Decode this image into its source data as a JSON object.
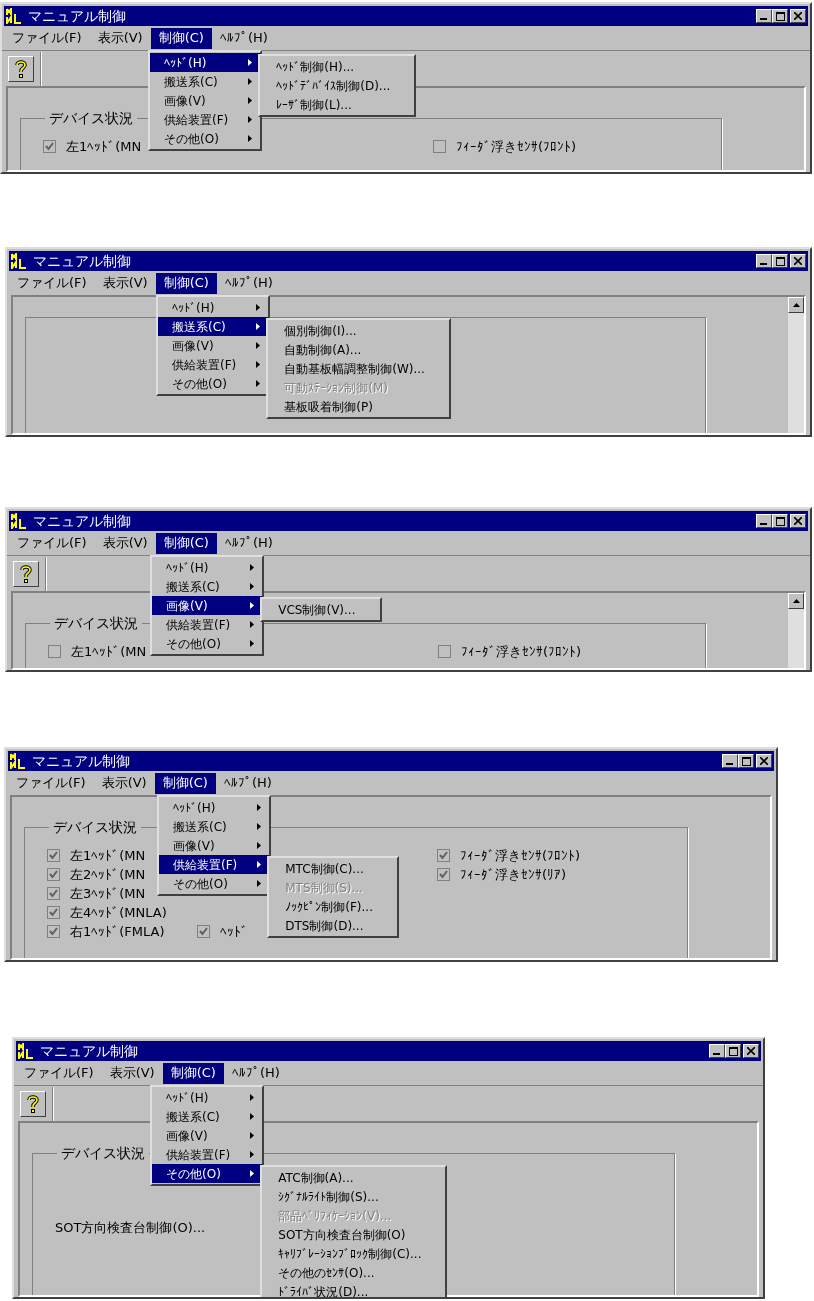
{
  "panels": [
    {
      "window": {
        "title": "マニュアル制御"
      },
      "menubar": [
        {
          "label": "ファイル(F)",
          "selected": false
        },
        {
          "label": "表示(V)",
          "selected": false
        },
        {
          "label": "制御(C)",
          "selected": true
        },
        {
          "label": "ﾍﾙﾌﾟ(H)",
          "selected": false
        }
      ],
      "toolbar": true,
      "scrollbar": false,
      "menu": [
        {
          "label": "ﾍｯﾄﾞ(H)",
          "selected": true
        },
        {
          "label": "搬送系(C)",
          "selected": false
        },
        {
          "label": "画像(V)",
          "selected": false
        },
        {
          "label": "供給装置(F)",
          "selected": false
        },
        {
          "label": "その他(O)",
          "selected": false
        }
      ],
      "submenu": [
        {
          "label": "ﾍｯﾄﾞ制御(H)...",
          "disabled": false
        },
        {
          "label": "ﾍｯﾄﾞﾃﾞﾊﾞｲｽ制御(D)...",
          "disabled": false
        },
        {
          "label": "ﾚｰｻﾞ制御(L)...",
          "disabled": false
        }
      ],
      "group": {
        "title": "デバイス状況",
        "rows": [
          {
            "left": {
              "label": "左1ﾍｯﾄﾞ(MN",
              "checked": true
            },
            "right": {
              "label": "ﾌｨｰﾀﾞ浮きｾﾝｻ(ﾌﾛﾝﾄ)",
              "checked": false
            }
          }
        ]
      }
    },
    {
      "window": {
        "title": "マニュアル制御"
      },
      "menubar": [
        {
          "label": "ファイル(F)",
          "selected": false
        },
        {
          "label": "表示(V)",
          "selected": false
        },
        {
          "label": "制御(C)",
          "selected": true
        },
        {
          "label": "ﾍﾙﾌﾟ(H)",
          "selected": false
        }
      ],
      "toolbar": false,
      "scrollbar": true,
      "menu": [
        {
          "label": "ﾍｯﾄﾞ(H)",
          "selected": false
        },
        {
          "label": "搬送系(C)",
          "selected": true
        },
        {
          "label": "画像(V)",
          "selected": false
        },
        {
          "label": "供給装置(F)",
          "selected": false
        },
        {
          "label": "その他(O)",
          "selected": false
        }
      ],
      "submenu": [
        {
          "label": "個別制御(I)...",
          "disabled": false
        },
        {
          "label": "自動制御(A)...",
          "disabled": false
        },
        {
          "label": "自動基板幅調整制御(W)...",
          "disabled": false
        },
        {
          "label": "可動ｽﾃｰｼｮﾝ制御(M)",
          "disabled": true
        },
        {
          "label": "基板吸着制御(P)",
          "disabled": false
        }
      ]
    },
    {
      "window": {
        "title": "マニュアル制御"
      },
      "menubar": [
        {
          "label": "ファイル(F)",
          "selected": false
        },
        {
          "label": "表示(V)",
          "selected": false
        },
        {
          "label": "制御(C)",
          "selected": true
        },
        {
          "label": "ﾍﾙﾌﾟ(H)",
          "selected": false
        }
      ],
      "toolbar": true,
      "scrollbar": true,
      "menu": [
        {
          "label": "ﾍｯﾄﾞ(H)",
          "selected": false
        },
        {
          "label": "搬送系(C)",
          "selected": false
        },
        {
          "label": "画像(V)",
          "selected": true
        },
        {
          "label": "供給装置(F)",
          "selected": false
        },
        {
          "label": "その他(O)",
          "selected": false
        }
      ],
      "submenu": [
        {
          "label": "VCS制御(V)...",
          "disabled": false
        }
      ],
      "group": {
        "title": "デバイス状況",
        "rows": [
          {
            "left": {
              "label": "左1ﾍｯﾄﾞ(MN",
              "checked": false
            },
            "right": {
              "label": "ﾌｨｰﾀﾞ浮きｾﾝｻ(ﾌﾛﾝﾄ)",
              "checked": false
            }
          }
        ]
      }
    },
    {
      "window": {
        "title": "マニュアル制御"
      },
      "menubar": [
        {
          "label": "ファイル(F)",
          "selected": false
        },
        {
          "label": "表示(V)",
          "selected": false
        },
        {
          "label": "制御(C)",
          "selected": true
        },
        {
          "label": "ﾍﾙﾌﾟ(H)",
          "selected": false
        }
      ],
      "toolbar": false,
      "scrollbar": false,
      "menu": [
        {
          "label": "ﾍｯﾄﾞ(H)",
          "selected": false
        },
        {
          "label": "搬送系(C)",
          "selected": false
        },
        {
          "label": "画像(V)",
          "selected": false
        },
        {
          "label": "供給装置(F)",
          "selected": true
        },
        {
          "label": "その他(O)",
          "selected": false
        }
      ],
      "submenu": [
        {
          "label": "MTC制御(C)...",
          "disabled": false
        },
        {
          "label": "MTS制御(S)...",
          "disabled": true
        },
        {
          "label": "ﾉｯｸﾋﾟﾝ制御(F)...",
          "disabled": false
        },
        {
          "label": "DTS制御(D)...",
          "disabled": false
        }
      ],
      "group": {
        "title": "デバイス状況",
        "rows": [
          {
            "left": {
              "label": "左1ﾍｯﾄﾞ(MN",
              "checked": true
            },
            "right": {
              "label": "ﾌｨｰﾀﾞ浮きｾﾝｻ(ﾌﾛﾝﾄ)",
              "checked": true
            }
          },
          {
            "left": {
              "label": "左2ﾍｯﾄﾞ(MN",
              "checked": true
            },
            "right": {
              "label": "ﾌｨｰﾀﾞ浮きｾﾝｻ(ﾘｱ)",
              "checked": true
            }
          },
          {
            "left": {
              "label": "左3ﾍｯﾄﾞ(MN",
              "checked": true
            }
          },
          {
            "left": {
              "label": "左4ﾍｯﾄﾞ(MNLA)",
              "checked": true
            }
          },
          {
            "left": {
              "label": "右1ﾍｯﾄﾞ(FMLA)",
              "checked": true
            },
            "middle": {
              "label": "ﾍｯﾄﾞ",
              "checked": true
            }
          }
        ]
      }
    },
    {
      "window": {
        "title": "マニュアル制御"
      },
      "menubar": [
        {
          "label": "ファイル(F)",
          "selected": false
        },
        {
          "label": "表示(V)",
          "selected": false
        },
        {
          "label": "制御(C)",
          "selected": true
        },
        {
          "label": "ﾍﾙﾌﾟ(H)",
          "selected": false
        }
      ],
      "toolbar": true,
      "scrollbar": false,
      "menu": [
        {
          "label": "ﾍｯﾄﾞ(H)",
          "selected": false
        },
        {
          "label": "搬送系(C)",
          "selected": false
        },
        {
          "label": "画像(V)",
          "selected": false
        },
        {
          "label": "供給装置(F)",
          "selected": false
        },
        {
          "label": "その他(O)",
          "selected": true
        }
      ],
      "submenu": [
        {
          "label": "ATC制御(A)...",
          "disabled": false
        },
        {
          "label": "ｼｸﾞﾅﾙﾗｲﾄ制御(S)...",
          "disabled": false
        },
        {
          "label": "部品ﾍﾞﾘﾌｨｹｰｼｮﾝ(V)...",
          "disabled": true
        },
        {
          "label": "SOT方向検査台制御(O)",
          "disabled": false
        },
        {
          "label": "ｷｬﾘﾌﾞﾚｰｼｮﾝﾌﾞﾛｯｸ制御(C)...",
          "disabled": false
        },
        {
          "label": "その他のｾﾝｻ(O)...",
          "disabled": false
        },
        {
          "label": "ﾄﾞﾗｲﾊﾞ状況(D)...",
          "disabled": false
        }
      ],
      "group": {
        "title": "デバイス状況",
        "note": "SOT方向検査台制御(O)..."
      }
    }
  ]
}
